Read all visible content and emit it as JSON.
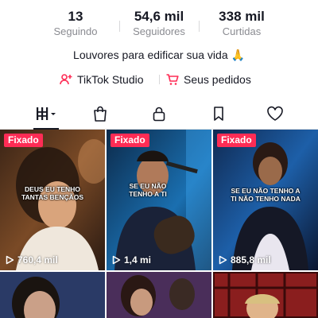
{
  "stats": [
    {
      "value": "13",
      "label": "Seguindo"
    },
    {
      "value": "54,6 mil",
      "label": "Seguidores"
    },
    {
      "value": "338 mil",
      "label": "Curtidas"
    }
  ],
  "bio": "Louvores para edificar sua vida 🙏",
  "links": {
    "studio": {
      "label": "TikTok Studio",
      "icon": "creator-studio-icon"
    },
    "orders": {
      "label": "Seus pedidos",
      "icon": "shopping-cart-icon"
    }
  },
  "tabs": [
    {
      "name": "videos",
      "icon": "grid-icon",
      "selected": true
    },
    {
      "name": "shop",
      "icon": "shopping-bag-icon"
    },
    {
      "name": "private",
      "icon": "lock-icon"
    },
    {
      "name": "saved",
      "icon": "bookmark-icon"
    },
    {
      "name": "liked",
      "icon": "heart-icon"
    }
  ],
  "videos": [
    {
      "pinned_label": "Fixado",
      "caption_l1": "DEUS EU TENHO",
      "caption_l2": "TANTAS BENÇÃOS",
      "views": "760,4 mil"
    },
    {
      "pinned_label": "Fixado",
      "caption_l1": "SE EU NÃO",
      "caption_l2": "TENHO A TI",
      "views": "1,4 mi"
    },
    {
      "pinned_label": "Fixado",
      "caption_l1": "SE EU NÃO TENHO A",
      "caption_l2": "TI NÃO TENHO NADA",
      "views": "885,8 mil"
    }
  ],
  "colors": {
    "accent": "#fe2c55",
    "text": "#161823",
    "muted": "#8a8b91"
  }
}
